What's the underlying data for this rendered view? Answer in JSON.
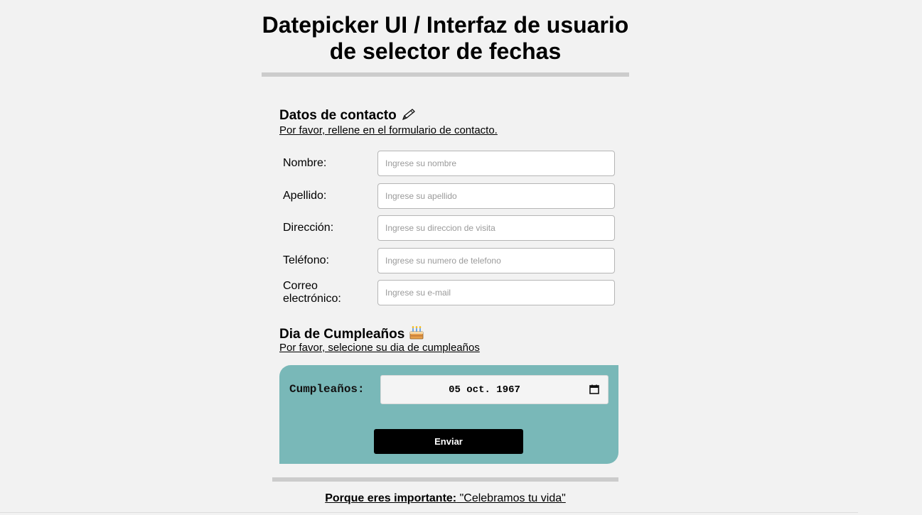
{
  "page_title": "Datepicker UI / Interfaz de usuario de selector de fechas",
  "contact": {
    "heading": "Datos de contacto",
    "heading_emoji": "🖊",
    "subtitle": "Por favor, rellene en el formulario de contacto.",
    "fields": [
      {
        "label": "Nombre:",
        "placeholder": "Ingrese su nombre",
        "value": ""
      },
      {
        "label": "Apellido:",
        "placeholder": "Ingrese su apellido",
        "value": ""
      },
      {
        "label": "Dirección:",
        "placeholder": "Ingrese su direccion de visita",
        "value": ""
      },
      {
        "label": "Teléfono:",
        "placeholder": "Ingrese su numero de telefono",
        "value": ""
      },
      {
        "label": "Correo electrónico:",
        "placeholder": "Ingrese su e-mail",
        "value": ""
      }
    ]
  },
  "birthday": {
    "heading": "Dia de Cumpleaños",
    "heading_emoji": "🎂",
    "subtitle": "Por favor, selecione su dia de cumpleaños",
    "label": "Cumpleaños:",
    "date_value": "05 oct. 1967",
    "submit_label": "Enviar",
    "panel_color": "#79b8b8"
  },
  "footer": {
    "strong": "Porque eres importante:",
    "quote": " \"Celebramos tu vida\""
  }
}
